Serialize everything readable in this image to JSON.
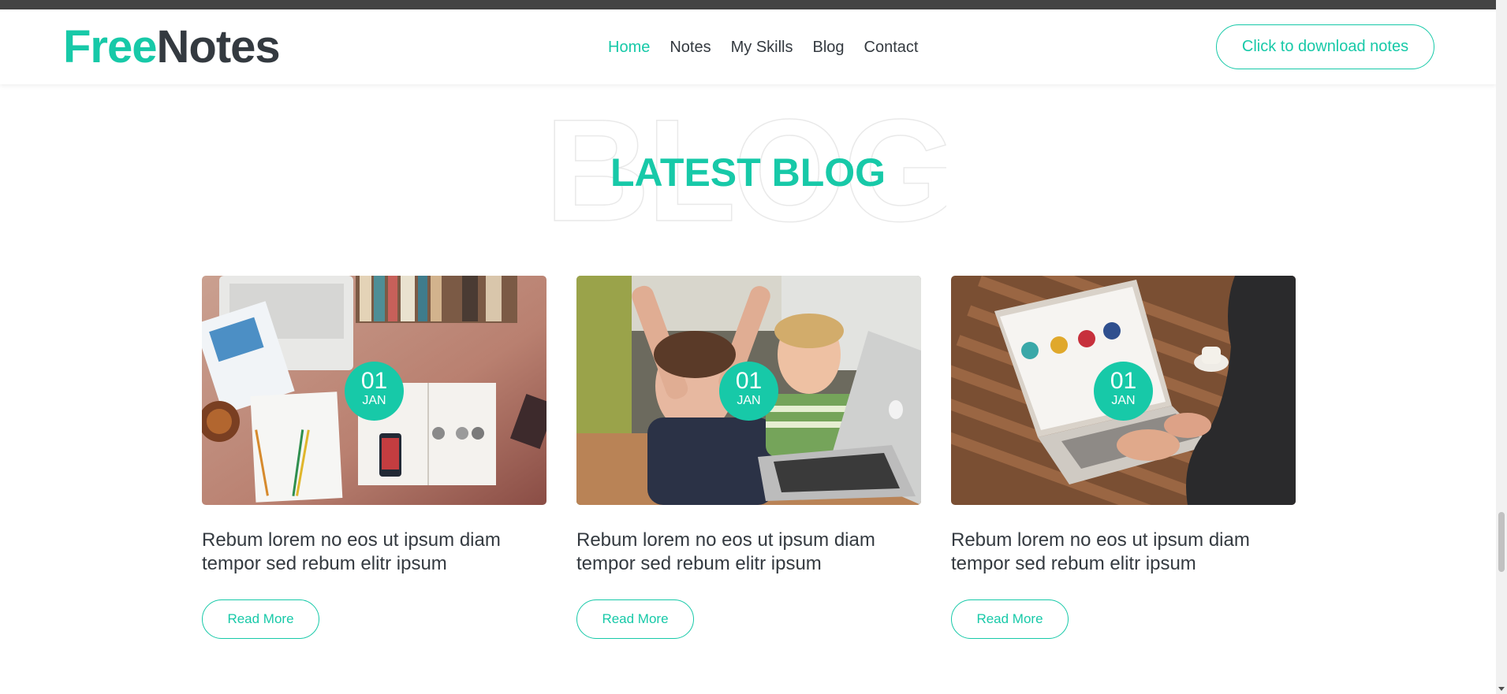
{
  "brand": {
    "part1": "Free",
    "part2": "Notes"
  },
  "nav": {
    "items": [
      {
        "label": "Home",
        "active": true
      },
      {
        "label": "Notes",
        "active": false
      },
      {
        "label": "My Skills",
        "active": false
      },
      {
        "label": "Blog",
        "active": false
      },
      {
        "label": "Contact",
        "active": false
      }
    ],
    "download_label": "Click to download notes"
  },
  "section": {
    "background_word": "BLOG",
    "title": "LATEST BLOG"
  },
  "posts": [
    {
      "day": "01",
      "month": "JAN",
      "title": "Rebum lorem no eos ut ipsum diam tempor sed rebum elitr ipsum",
      "cta": "Read More"
    },
    {
      "day": "01",
      "month": "JAN",
      "title": "Rebum lorem no eos ut ipsum diam tempor sed rebum elitr ipsum",
      "cta": "Read More"
    },
    {
      "day": "01",
      "month": "JAN",
      "title": "Rebum lorem no eos ut ipsum diam tempor sed rebum elitr ipsum",
      "cta": "Read More"
    }
  ],
  "colors": {
    "accent": "#17c9a8",
    "text": "#343a40",
    "topbar": "#444444"
  }
}
